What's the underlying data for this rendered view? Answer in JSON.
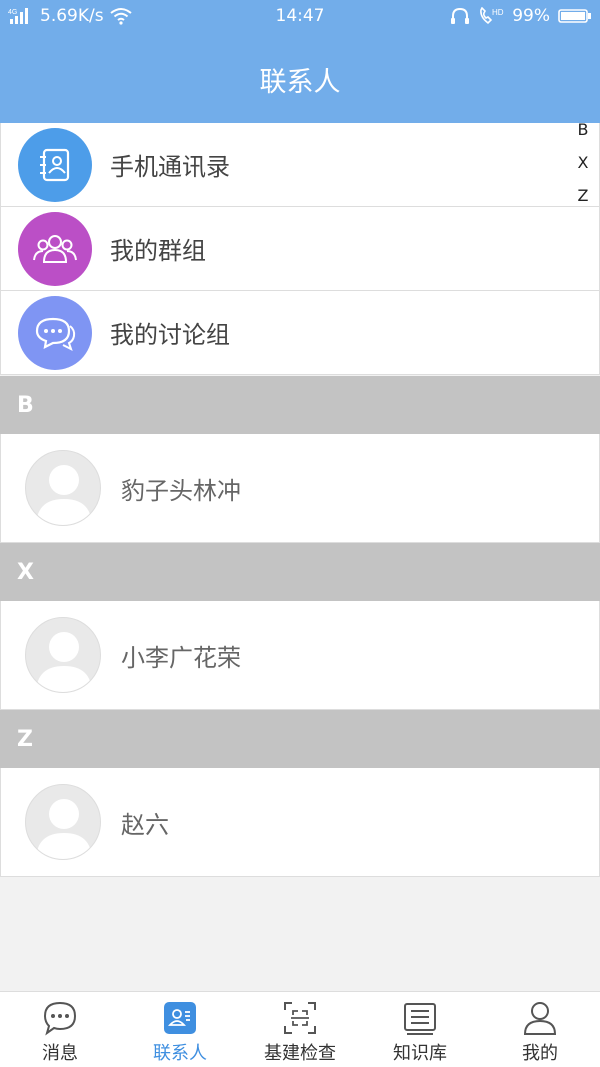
{
  "status_bar": {
    "network": "4G",
    "speed": "5.69K/s",
    "time": "14:47",
    "battery": "99%"
  },
  "header": {
    "title": "联系人"
  },
  "functions": [
    {
      "label": "手机通讯录",
      "icon": "address-book-icon",
      "color": "#4d9de9"
    },
    {
      "label": "我的群组",
      "icon": "group-icon",
      "color": "#bb4fc6"
    },
    {
      "label": "我的讨论组",
      "icon": "chat-bubbles-icon",
      "color": "#7f95f3"
    }
  ],
  "sections": [
    {
      "letter": "B",
      "contacts": [
        {
          "name": "豹子头林冲"
        }
      ]
    },
    {
      "letter": "X",
      "contacts": [
        {
          "name": "小李广花荣"
        }
      ]
    },
    {
      "letter": "Z",
      "contacts": [
        {
          "name": "赵六"
        }
      ]
    }
  ],
  "index_letters": [
    "B",
    "X",
    "Z"
  ],
  "bottom_nav": [
    {
      "label": "消息",
      "icon": "message-icon",
      "active": false
    },
    {
      "label": "联系人",
      "icon": "contacts-icon",
      "active": true
    },
    {
      "label": "基建检查",
      "icon": "scan-icon",
      "active": false
    },
    {
      "label": "知识库",
      "icon": "document-icon",
      "active": false
    },
    {
      "label": "我的",
      "icon": "profile-icon",
      "active": false
    }
  ],
  "colors": {
    "header": "#72adea",
    "active": "#3f8fe0",
    "section_header": "#c3c3c3"
  }
}
